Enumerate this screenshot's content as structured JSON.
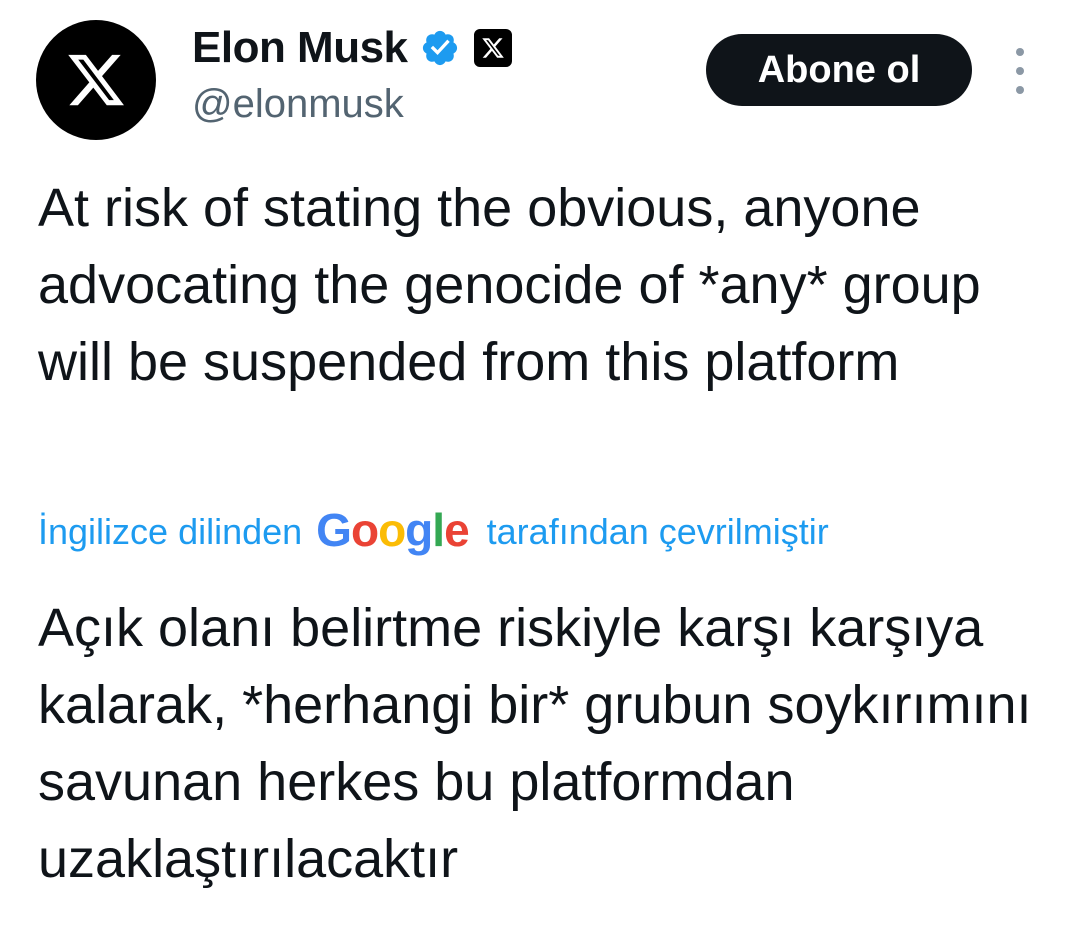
{
  "author": {
    "avatar_icon": "x-logo-icon",
    "display_name": "Elon Musk",
    "verified_icon": "verified-badge-icon",
    "verified_color": "#1d9bf0",
    "affiliate_icon": "x-affiliate-badge-icon",
    "handle": "@elonmusk"
  },
  "follow_button": {
    "label": "Abone ol"
  },
  "more_menu_icon": "more-vertical-icon",
  "tweet": {
    "text": "At risk of stating the obvious, anyone advocating the genocide of *any* group will be suspended from this platform"
  },
  "translation": {
    "prefix": "İngilizce dilinden",
    "provider": "Google",
    "suffix": "tarafından çevrilmiştir",
    "link_color": "#1d9bf0",
    "text": "Açık olanı belirtme riskiyle karşı karşıya kalarak, *herhangi bir* grubun soykırımını savunan herkes bu platformdan uzaklaştırılacaktır"
  }
}
